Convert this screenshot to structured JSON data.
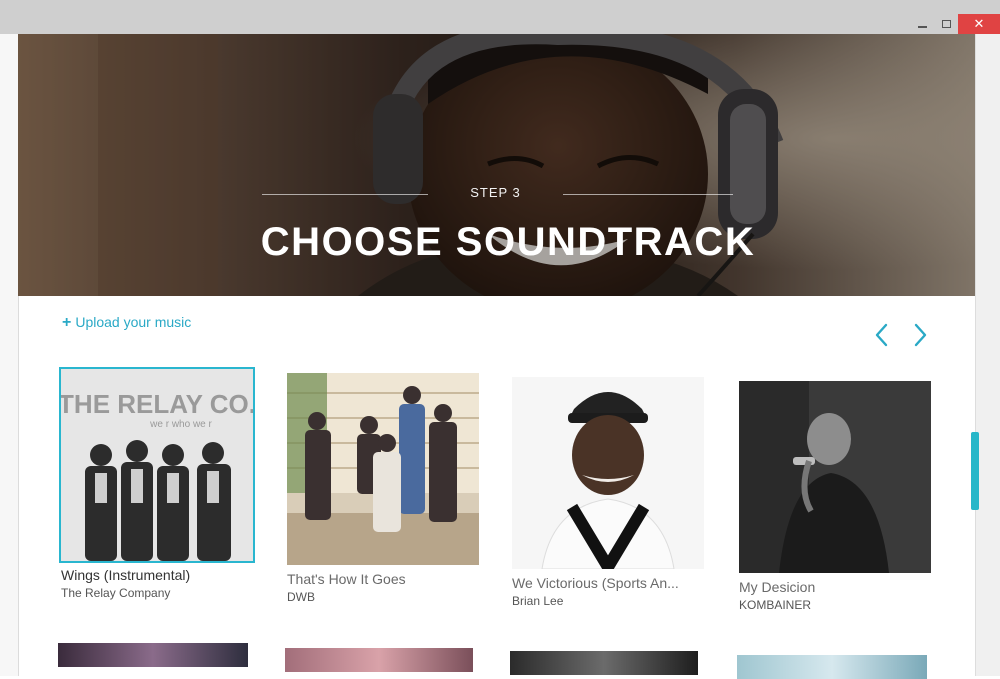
{
  "window": {
    "minimize_icon": "minimize-icon",
    "maximize_icon": "maximize-icon",
    "close_icon": "close-icon",
    "close_glyph": "✕",
    "close_color": "#e04343"
  },
  "hero": {
    "step": "STEP 3",
    "title": "CHOOSE SOUNDTRACK"
  },
  "controls": {
    "upload_plus": "+",
    "upload_label": "Upload your music",
    "prev_icon": "chevron-left-icon",
    "next_icon": "chevron-right-icon",
    "accent_color": "#2aa9c6"
  },
  "tracks": [
    {
      "title": "Wings (Instrumental)",
      "artist": "The Relay Company",
      "selected": true,
      "cover_text": "THE RELAY CO.",
      "cover_subtext": "we r who we r"
    },
    {
      "title": "That's How It Goes",
      "artist": "DWB",
      "selected": false
    },
    {
      "title": "We Victorious (Sports An...",
      "artist": "Brian Lee",
      "selected": false
    },
    {
      "title": "My Desicion",
      "artist": "KOMBAINER",
      "selected": false
    }
  ]
}
